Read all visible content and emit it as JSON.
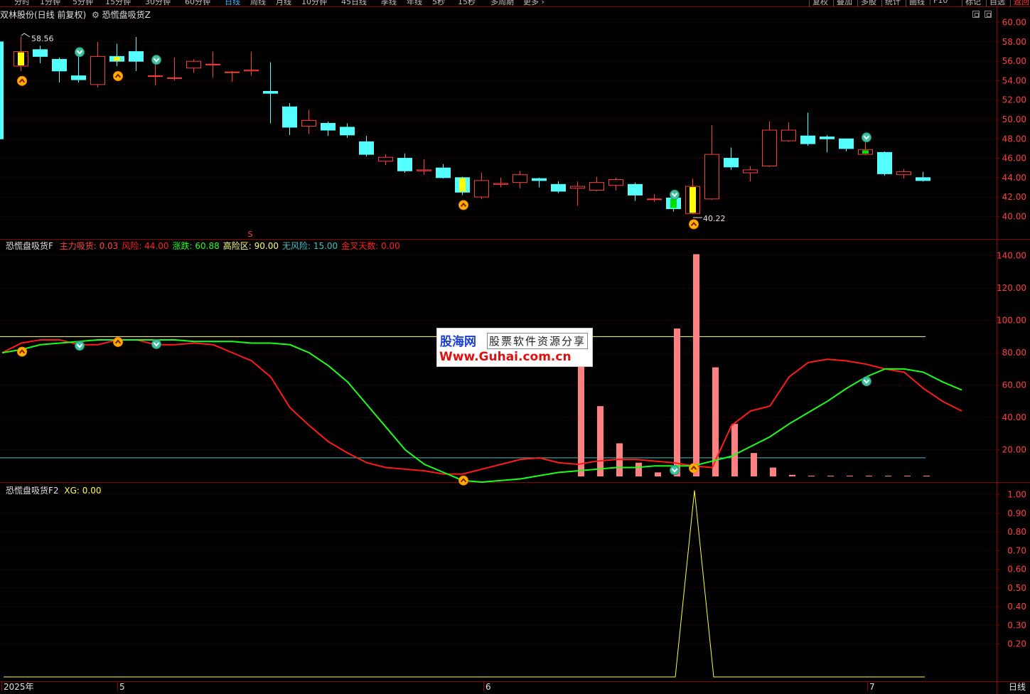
{
  "toolbar": {
    "periods": [
      "分时",
      "1分钟",
      "5分钟",
      "15分钟",
      "30分钟",
      "60分钟",
      "日线",
      "周线",
      "月线",
      "10分钟",
      "45日线",
      "季线",
      "年线",
      "5秒",
      "15秒",
      "多周期",
      "更多 ›"
    ],
    "active_period": "日线",
    "right_buttons": [
      "复权",
      "叠加",
      "多股",
      "统计",
      "画线",
      "F10",
      "标记",
      "自选",
      "返回"
    ]
  },
  "main_panel": {
    "title_stock": "双林股份(日线 前复权)",
    "title_indicator": "恐慌盘吸货Z",
    "high_label": "58.56",
    "low_label": "40.22",
    "s_marker": "S",
    "y_axis": [
      "60.00",
      "58.00",
      "56.00",
      "54.00",
      "52.00",
      "50.00",
      "48.00",
      "46.00",
      "44.00",
      "42.00",
      "40.00"
    ]
  },
  "indicator_panel": {
    "name": "恐慌盘吸货F",
    "items": [
      {
        "label": "主力吸货:",
        "value": "0.03",
        "color": "#ff4040"
      },
      {
        "label": "风险:",
        "value": "44.00",
        "color": "#ff2020"
      },
      {
        "label": "涨跌:",
        "value": "60.88",
        "color": "#20ff20"
      },
      {
        "label": "高险区:",
        "value": "90.00",
        "color": "#ffff80"
      },
      {
        "label": "无风险:",
        "value": "15.00",
        "color": "#40c0c0"
      },
      {
        "label": "金叉天数:",
        "value": "0.00",
        "color": "#ff2020"
      }
    ],
    "y_axis": [
      "140.00",
      "120.00",
      "100.00",
      "80.00",
      "60.00",
      "40.00",
      "20.00"
    ]
  },
  "xg_panel": {
    "name": "恐慌盘吸货F2",
    "label": "XG:",
    "value": "0.00",
    "y_axis": [
      "1.00",
      "0.90",
      "0.80",
      "0.70",
      "0.60",
      "0.50",
      "0.40",
      "0.30",
      "0.20"
    ]
  },
  "x_axis": [
    "2025年",
    "5",
    "6",
    "7"
  ],
  "period_label": "日线",
  "watermark": {
    "brand": "股海网",
    "tagline": "股票软件资源分享",
    "url": "Www.Guhai.com.cn"
  },
  "colors": {
    "up": "#ff3c3c",
    "down": "#54ffff",
    "frame": "#8b0000",
    "risk_line": "#ff1a1a",
    "trend_line": "#1aff1a",
    "high_risk_line": "#ffff99",
    "no_risk_line": "#40c0c0",
    "xg_line": "#ffff40",
    "bars": "#ff8080"
  },
  "chart_data": [
    {
      "type": "candlestick",
      "title": "双林股份(日线 前复权)",
      "ylim": [
        39,
        61
      ],
      "candles": [
        {
          "o": 58.0,
          "h": 58.3,
          "c": 48.0,
          "l": 47.8
        },
        {
          "o": 55.5,
          "h": 58.56,
          "c": 57.0,
          "l": 55.0
        },
        {
          "o": 57.2,
          "h": 57.6,
          "c": 56.5,
          "l": 55.8
        },
        {
          "o": 56.2,
          "h": 56.4,
          "c": 55.0,
          "l": 53.8
        },
        {
          "o": 54.5,
          "h": 56.8,
          "c": 54.1,
          "l": 53.8
        },
        {
          "o": 53.6,
          "h": 58.0,
          "c": 56.5,
          "l": 53.3
        },
        {
          "o": 56.5,
          "h": 57.8,
          "c": 56.0,
          "l": 55.5
        },
        {
          "o": 57.0,
          "h": 58.5,
          "c": 56.0,
          "l": 55.0
        },
        {
          "o": 54.5,
          "h": 56.0,
          "c": 54.5,
          "l": 53.5
        },
        {
          "o": 54.3,
          "h": 56.4,
          "c": 54.3,
          "l": 54.0
        },
        {
          "o": 55.3,
          "h": 56.2,
          "c": 56.0,
          "l": 54.8
        },
        {
          "o": 55.7,
          "h": 57.0,
          "c": 55.7,
          "l": 54.3
        },
        {
          "o": 54.9,
          "h": 55.0,
          "c": 54.9,
          "l": 53.9
        },
        {
          "o": 55.0,
          "h": 57.0,
          "c": 55.1,
          "l": 54.5
        },
        {
          "o": 52.9,
          "h": 55.9,
          "c": 52.7,
          "l": 49.6
        },
        {
          "o": 51.3,
          "h": 51.7,
          "c": 49.2,
          "l": 48.4
        },
        {
          "o": 49.3,
          "h": 51.0,
          "c": 49.9,
          "l": 48.5
        },
        {
          "o": 49.6,
          "h": 49.8,
          "c": 48.9,
          "l": 48.3
        },
        {
          "o": 49.2,
          "h": 49.6,
          "c": 48.4,
          "l": 48.1
        },
        {
          "o": 47.7,
          "h": 48.3,
          "c": 46.4,
          "l": 46.2
        },
        {
          "o": 45.7,
          "h": 46.4,
          "c": 46.1,
          "l": 45.3
        },
        {
          "o": 46.0,
          "h": 46.5,
          "c": 44.7,
          "l": 44.5
        },
        {
          "o": 44.7,
          "h": 45.9,
          "c": 44.8,
          "l": 44.3
        },
        {
          "o": 45.0,
          "h": 45.4,
          "c": 44.0,
          "l": 43.9
        },
        {
          "o": 44.0,
          "h": 44.1,
          "c": 42.5,
          "l": 42.2
        },
        {
          "o": 42.0,
          "h": 44.5,
          "c": 43.7,
          "l": 41.8
        },
        {
          "o": 43.3,
          "h": 44.0,
          "c": 43.4,
          "l": 43.0
        },
        {
          "o": 43.5,
          "h": 44.7,
          "c": 44.3,
          "l": 42.9
        },
        {
          "o": 43.9,
          "h": 44.0,
          "c": 43.7,
          "l": 43.0
        },
        {
          "o": 43.3,
          "h": 43.6,
          "c": 42.6,
          "l": 42.4
        },
        {
          "o": 42.9,
          "h": 43.6,
          "c": 43.1,
          "l": 41.1
        },
        {
          "o": 42.7,
          "h": 44.1,
          "c": 43.5,
          "l": 42.6
        },
        {
          "o": 43.2,
          "h": 44.0,
          "c": 43.8,
          "l": 42.7
        },
        {
          "o": 43.3,
          "h": 43.5,
          "c": 42.2,
          "l": 41.6
        },
        {
          "o": 41.8,
          "h": 42.3,
          "c": 41.8,
          "l": 41.5
        },
        {
          "o": 41.9,
          "h": 42.1,
          "c": 40.8,
          "l": 40.5
        },
        {
          "o": 40.3,
          "h": 43.9,
          "c": 43.1,
          "l": 40.22
        },
        {
          "o": 41.8,
          "h": 49.4,
          "c": 46.4,
          "l": 41.7
        },
        {
          "o": 46.0,
          "h": 47.1,
          "c": 45.1,
          "l": 44.8
        },
        {
          "o": 44.5,
          "h": 45.2,
          "c": 44.8,
          "l": 43.6
        },
        {
          "o": 45.2,
          "h": 49.8,
          "c": 48.9,
          "l": 45.1
        },
        {
          "o": 47.8,
          "h": 49.7,
          "c": 48.9,
          "l": 47.7
        },
        {
          "o": 48.3,
          "h": 50.7,
          "c": 47.5,
          "l": 47.3
        },
        {
          "o": 48.2,
          "h": 48.4,
          "c": 48.0,
          "l": 46.6
        },
        {
          "o": 48.0,
          "h": 48.0,
          "c": 47.0,
          "l": 46.7
        },
        {
          "o": 46.4,
          "h": 48.0,
          "c": 46.9,
          "l": 46.3
        },
        {
          "o": 46.6,
          "h": 46.7,
          "c": 44.4,
          "l": 44.2
        },
        {
          "o": 44.3,
          "h": 44.9,
          "c": 44.6,
          "l": 43.9
        },
        {
          "o": 44.0,
          "h": 44.6,
          "c": 43.7,
          "l": 43.6
        }
      ],
      "highlight_candles": [
        1,
        6,
        24,
        36
      ],
      "green_highlight_candles": [
        35,
        45
      ],
      "buy_markers": [
        1,
        6,
        24,
        36
      ],
      "sell_markers": [
        4,
        8,
        35,
        45
      ]
    },
    {
      "type": "line",
      "title": "恐慌盘吸货F",
      "ylim": [
        0,
        150
      ],
      "series": [
        {
          "name": "风险",
          "color": "#ff1a1a",
          "values": [
            80,
            86,
            88,
            88,
            85,
            85,
            88,
            88,
            85,
            85,
            86,
            85,
            80,
            75,
            65,
            46,
            35,
            25,
            18,
            12,
            9,
            8,
            7,
            5,
            5,
            8,
            11,
            14,
            15,
            12,
            11,
            13,
            14,
            14,
            13,
            12,
            10,
            9,
            35,
            44,
            47,
            65,
            74,
            76,
            75,
            73,
            70,
            68,
            58,
            50,
            44
          ]
        },
        {
          "name": "涨跌",
          "color": "#1aff1a",
          "values": [
            80,
            82,
            85,
            86,
            87,
            88,
            88,
            88,
            88,
            88,
            87,
            87,
            87,
            86,
            86,
            85,
            80,
            72,
            62,
            48,
            34,
            20,
            11,
            6,
            1,
            0,
            1,
            2,
            4,
            6,
            7,
            8,
            9,
            9,
            10,
            10,
            10,
            13,
            16,
            22,
            28,
            36,
            43,
            50,
            58,
            65,
            70,
            70,
            68,
            62,
            57
          ]
        }
      ],
      "high_risk_level": 90,
      "no_risk_level": 15,
      "bars": [
        {
          "x": 30,
          "v": 93
        },
        {
          "x": 31,
          "v": 47
        },
        {
          "x": 32,
          "v": 24
        },
        {
          "x": 33,
          "v": 12
        },
        {
          "x": 34,
          "v": 6
        },
        {
          "x": 35,
          "v": 95
        },
        {
          "x": 36,
          "v": 141
        },
        {
          "x": 37,
          "v": 71
        },
        {
          "x": 38,
          "v": 36
        },
        {
          "x": 39,
          "v": 18
        },
        {
          "x": 40,
          "v": 9
        },
        {
          "x": 41,
          "v": 4.5
        },
        {
          "x": 42,
          "v": 2.2
        },
        {
          "x": 43,
          "v": 1.1
        },
        {
          "x": 44,
          "v": 0.6
        },
        {
          "x": 45,
          "v": 0.3
        },
        {
          "x": 46,
          "v": 0.15
        },
        {
          "x": 47,
          "v": 0.08
        },
        {
          "x": 48,
          "v": 0.04
        }
      ],
      "buy_markers": [
        1,
        6,
        24,
        36
      ],
      "sell_markers": [
        4,
        8,
        35,
        45
      ]
    },
    {
      "type": "line",
      "title": "恐慌盘吸货F2",
      "ylim": [
        0,
        1.06
      ],
      "series": [
        {
          "name": "XG",
          "color": "#ffff40",
          "values": [
            0,
            0,
            0,
            0,
            0,
            0,
            0,
            0,
            0,
            0,
            0,
            0,
            0,
            0,
            0,
            0,
            0,
            0,
            0,
            0,
            0,
            0,
            0,
            0,
            0,
            0,
            0,
            0,
            0,
            0,
            0,
            0,
            0,
            0,
            0,
            0,
            1,
            0,
            0,
            0,
            0,
            0,
            0,
            0,
            0,
            0,
            0,
            0,
            0
          ]
        }
      ]
    }
  ]
}
